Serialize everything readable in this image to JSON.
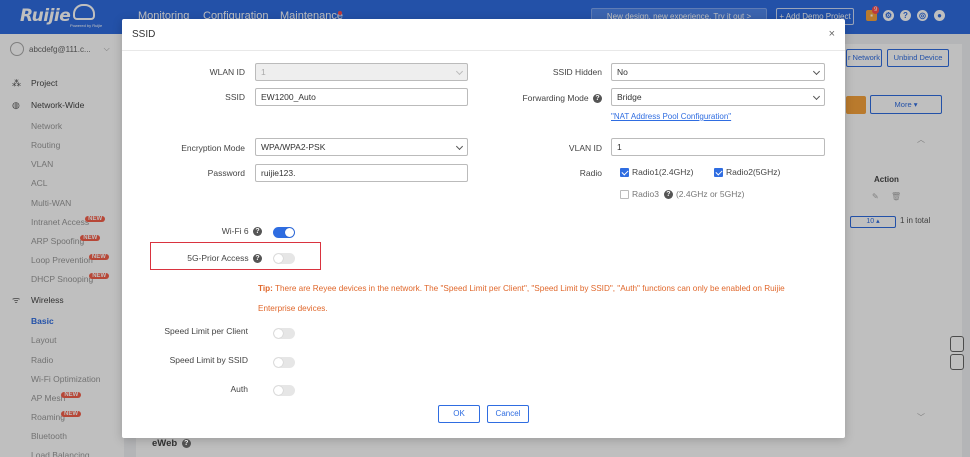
{
  "topbar": {
    "brand": "Ruijie",
    "brand_sub": "Powered by Ruijie",
    "nav": [
      "Monitoring",
      "Configuration",
      "Maintenance"
    ],
    "promo": "New design, new experience. Try it out  >",
    "demo_button": "+ Add Demo Project",
    "notif_count": "9"
  },
  "sidebar": {
    "account": "abcdefg@111.c...",
    "items": [
      {
        "label": "Project",
        "top": true,
        "icon": "project-icon"
      },
      {
        "label": "Network-Wide",
        "top": true,
        "icon": "globe-icon"
      },
      {
        "label": "Network"
      },
      {
        "label": "Routing"
      },
      {
        "label": "VLAN"
      },
      {
        "label": "ACL"
      },
      {
        "label": "Multi-WAN"
      },
      {
        "label": "Intranet Access",
        "badge": "NEW"
      },
      {
        "label": "ARP Spoofing",
        "badge": "NEW"
      },
      {
        "label": "Loop Prevention",
        "badge": "NEW"
      },
      {
        "label": "DHCP Snooping",
        "badge": "NEW"
      },
      {
        "label": "Wireless",
        "top": true,
        "icon": "wifi-icon"
      },
      {
        "label": "Basic",
        "active": true
      },
      {
        "label": "Layout"
      },
      {
        "label": "Radio"
      },
      {
        "label": "Wi-Fi Optimization"
      },
      {
        "label": "AP Mesh",
        "badge": "NEW"
      },
      {
        "label": "Roaming",
        "badge": "NEW"
      },
      {
        "label": "Bluetooth"
      },
      {
        "label": "Load Balancing"
      }
    ]
  },
  "background": {
    "btn_network": "r Network",
    "btn_unbind": "Unbind Device",
    "btn_more": "More ▾",
    "action_header": "Action",
    "page_size": "10 ▴",
    "total": "1 in total",
    "eweb": "eWeb"
  },
  "modal": {
    "title": "SSID",
    "close": "×",
    "wlan_id_label": "WLAN ID",
    "wlan_id_value": "1",
    "ssid_hidden_label": "SSID Hidden",
    "ssid_hidden_value": "No",
    "ssid_label": "SSID",
    "ssid_value": "EW1200_Auto",
    "forwarding_label": "Forwarding Mode",
    "forwarding_value": "Bridge",
    "nat_link": "\"NAT Address Pool Configuration\"",
    "encryption_label": "Encryption Mode",
    "encryption_value": "WPA/WPA2-PSK",
    "vlan_label": "VLAN ID",
    "vlan_value": "1",
    "password_label": "Password",
    "password_value": "ruijie123.",
    "radio_label": "Radio",
    "radio1": "Radio1(2.4GHz)",
    "radio2": "Radio2(5GHz)",
    "radio3": "Radio3",
    "radio3_note": "(2.4GHz or 5GHz)",
    "wifi6_label": "Wi-Fi 6",
    "prior_label": "5G-Prior Access",
    "tip_prefix": "Tip:",
    "tip_text": " There are Reyee devices in the network. The \"Speed Limit per Client\", \"Speed Limit by SSID\", \"Auth\" functions can only be enabled on Ruijie Enterprise devices.",
    "speed_client_label": "Speed Limit per Client",
    "speed_ssid_label": "Speed Limit by SSID",
    "auth_label": "Auth",
    "ok": "OK",
    "cancel": "Cancel",
    "help": "?"
  },
  "colors": {
    "brand": "#2f6de1",
    "tip": "#e0672b",
    "highlight": "#d9333f"
  }
}
